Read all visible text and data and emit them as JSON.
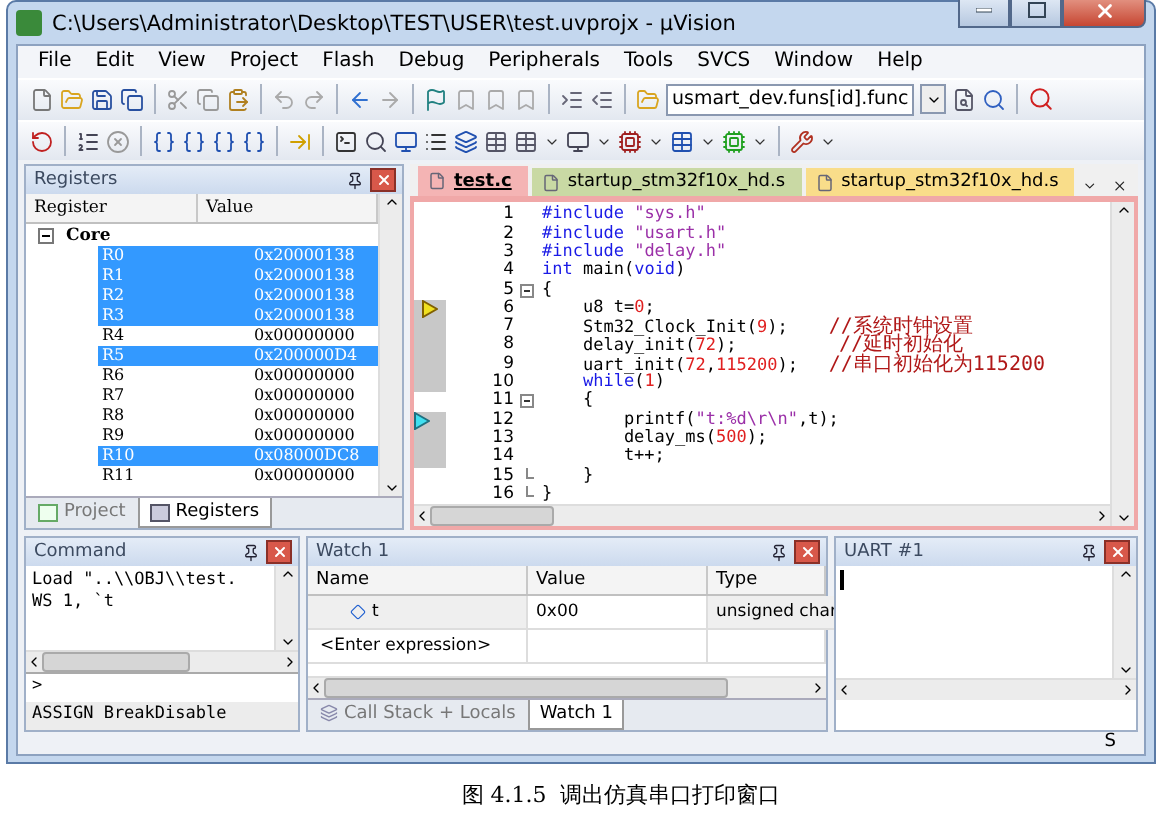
{
  "window": {
    "title": "C:\\Users\\Administrator\\Desktop\\TEST\\USER\\test.uvprojx - µVision"
  },
  "menu": [
    "File",
    "Edit",
    "View",
    "Project",
    "Flash",
    "Debug",
    "Peripherals",
    "Tools",
    "SVCS",
    "Window",
    "Help"
  ],
  "toolbar": {
    "find_field": "usmart_dev.funs[id].func"
  },
  "registers_panel": {
    "title": "Registers",
    "columns": [
      "Register",
      "Value"
    ],
    "group": {
      "name": "Core",
      "expanded": true,
      "children": [
        {
          "name": "R0",
          "value": "0x20000138",
          "selected": true
        },
        {
          "name": "R1",
          "value": "0x20000138",
          "selected": true
        },
        {
          "name": "R2",
          "value": "0x20000138",
          "selected": true
        },
        {
          "name": "R3",
          "value": "0x20000138",
          "selected": true
        },
        {
          "name": "R4",
          "value": "0x00000000",
          "selected": false
        },
        {
          "name": "R5",
          "value": "0x200000D4",
          "selected": true
        },
        {
          "name": "R6",
          "value": "0x00000000",
          "selected": false
        },
        {
          "name": "R7",
          "value": "0x00000000",
          "selected": false
        },
        {
          "name": "R8",
          "value": "0x00000000",
          "selected": false
        },
        {
          "name": "R9",
          "value": "0x00000000",
          "selected": false
        },
        {
          "name": "R10",
          "value": "0x08000DC8",
          "selected": true
        },
        {
          "name": "R11",
          "value": "0x00000000",
          "selected": false
        }
      ]
    },
    "tabs": [
      {
        "label": "Project",
        "selected": false
      },
      {
        "label": "Registers",
        "selected": true
      }
    ]
  },
  "editor": {
    "tabs": [
      {
        "label": "test.c",
        "selected": true,
        "color": "#f4b4b4"
      },
      {
        "label": "startup_stm32f10x_hd.s",
        "selected": false,
        "color": "#c9d9a4"
      },
      {
        "label": "startup_stm32f10x_hd.s",
        "selected": false,
        "color": "#f9dd8a"
      }
    ],
    "lines": [
      {
        "number": "1",
        "fold_start": false,
        "fold_end": false,
        "current_line": false,
        "caller_line": false,
        "segments": [
          {
            "kind": "keyword",
            "text": "#include"
          },
          {
            "kind": "string",
            "text": " \"sys.h\""
          }
        ]
      },
      {
        "number": "2",
        "fold_start": false,
        "fold_end": false,
        "current_line": false,
        "caller_line": false,
        "segments": [
          {
            "kind": "keyword",
            "text": "#include"
          },
          {
            "kind": "string",
            "text": " \"usart.h\""
          }
        ]
      },
      {
        "number": "3",
        "fold_start": false,
        "fold_end": false,
        "current_line": false,
        "caller_line": false,
        "segments": [
          {
            "kind": "keyword",
            "text": "#include"
          },
          {
            "kind": "string",
            "text": " \"delay.h\""
          }
        ]
      },
      {
        "number": "4",
        "fold_start": false,
        "fold_end": false,
        "current_line": false,
        "caller_line": false,
        "segments": [
          {
            "kind": "keyword",
            "text": "int"
          },
          {
            "kind": "plain",
            "text": " main("
          },
          {
            "kind": "keyword",
            "text": "void"
          },
          {
            "kind": "plain",
            "text": ")"
          }
        ]
      },
      {
        "number": "5",
        "fold_start": true,
        "fold_end": false,
        "current_line": false,
        "caller_line": false,
        "segments": [
          {
            "kind": "plain",
            "text": "{"
          }
        ]
      },
      {
        "number": "6",
        "fold_start": false,
        "fold_end": false,
        "current_line": true,
        "caller_line": false,
        "segments": [
          {
            "kind": "plain",
            "text": "    u8 t="
          },
          {
            "kind": "number",
            "text": "0"
          },
          {
            "kind": "plain",
            "text": ";"
          }
        ]
      },
      {
        "number": "7",
        "fold_start": false,
        "fold_end": false,
        "current_line": false,
        "caller_line": false,
        "segments": [
          {
            "kind": "plain",
            "text": "    Stm32_Clock_Init("
          },
          {
            "kind": "number",
            "text": "9"
          },
          {
            "kind": "plain",
            "text": ");    "
          },
          {
            "kind": "comment",
            "text": "//系统时钟设置"
          }
        ]
      },
      {
        "number": "8",
        "fold_start": false,
        "fold_end": false,
        "current_line": false,
        "caller_line": false,
        "segments": [
          {
            "kind": "plain",
            "text": "    delay_init("
          },
          {
            "kind": "number",
            "text": "72"
          },
          {
            "kind": "plain",
            "text": ");          "
          },
          {
            "kind": "comment",
            "text": "//延时初始化"
          }
        ]
      },
      {
        "number": "9",
        "fold_start": false,
        "fold_end": false,
        "current_line": false,
        "caller_line": false,
        "segments": [
          {
            "kind": "plain",
            "text": "    uart_init("
          },
          {
            "kind": "number",
            "text": "72"
          },
          {
            "kind": "plain",
            "text": ","
          },
          {
            "kind": "number",
            "text": "115200"
          },
          {
            "kind": "plain",
            "text": ");   "
          },
          {
            "kind": "comment",
            "text": "//串口初始化为115200"
          }
        ]
      },
      {
        "number": "10",
        "fold_start": false,
        "fold_end": false,
        "current_line": false,
        "caller_line": false,
        "segments": [
          {
            "kind": "keyword",
            "text": "    while"
          },
          {
            "kind": "plain",
            "text": "("
          },
          {
            "kind": "number",
            "text": "1"
          },
          {
            "kind": "plain",
            "text": ")"
          }
        ]
      },
      {
        "number": "11",
        "fold_start": true,
        "fold_end": false,
        "current_line": false,
        "caller_line": false,
        "segments": [
          {
            "kind": "plain",
            "text": "    {"
          }
        ]
      },
      {
        "number": "12",
        "fold_start": false,
        "fold_end": false,
        "current_line": false,
        "caller_line": true,
        "segments": [
          {
            "kind": "plain",
            "text": "        printf("
          },
          {
            "kind": "string",
            "text": "\"t:%d\\r\\n\""
          },
          {
            "kind": "plain",
            "text": ",t);"
          }
        ]
      },
      {
        "number": "13",
        "fold_start": false,
        "fold_end": false,
        "current_line": false,
        "caller_line": false,
        "segments": [
          {
            "kind": "plain",
            "text": "        delay_ms("
          },
          {
            "kind": "number",
            "text": "500"
          },
          {
            "kind": "plain",
            "text": ");"
          }
        ]
      },
      {
        "number": "14",
        "fold_start": false,
        "fold_end": false,
        "current_line": false,
        "caller_line": false,
        "segments": [
          {
            "kind": "plain",
            "text": "        t++;"
          }
        ]
      },
      {
        "number": "15",
        "fold_start": false,
        "fold_end": true,
        "current_line": false,
        "caller_line": false,
        "segments": [
          {
            "kind": "plain",
            "text": "    }"
          }
        ]
      },
      {
        "number": "16",
        "fold_start": false,
        "fold_end": true,
        "current_line": false,
        "caller_line": false,
        "segments": [
          {
            "kind": "plain",
            "text": "}"
          }
        ]
      }
    ]
  },
  "command_panel": {
    "title": "Command",
    "output": [
      "Load \"..\\\\OBJ\\\\test.",
      "WS 1, `t"
    ],
    "prompt": ">",
    "hint": "ASSIGN BreakDisable"
  },
  "watch_panel": {
    "title": "Watch 1",
    "columns": [
      "Name",
      "Value",
      "Type"
    ],
    "rows": [
      {
        "name": "t",
        "value": "0x00",
        "type": "unsigned char"
      }
    ],
    "new_row": "<Enter expression>",
    "tabs": [
      {
        "label": "Call Stack + Locals",
        "selected": false
      },
      {
        "label": "Watch 1",
        "selected": true
      }
    ]
  },
  "uart_panel": {
    "title": "UART #1"
  },
  "status_bar": {
    "text": "S"
  },
  "caption": "图 4.1.5  调出仿真串口打印窗口"
}
